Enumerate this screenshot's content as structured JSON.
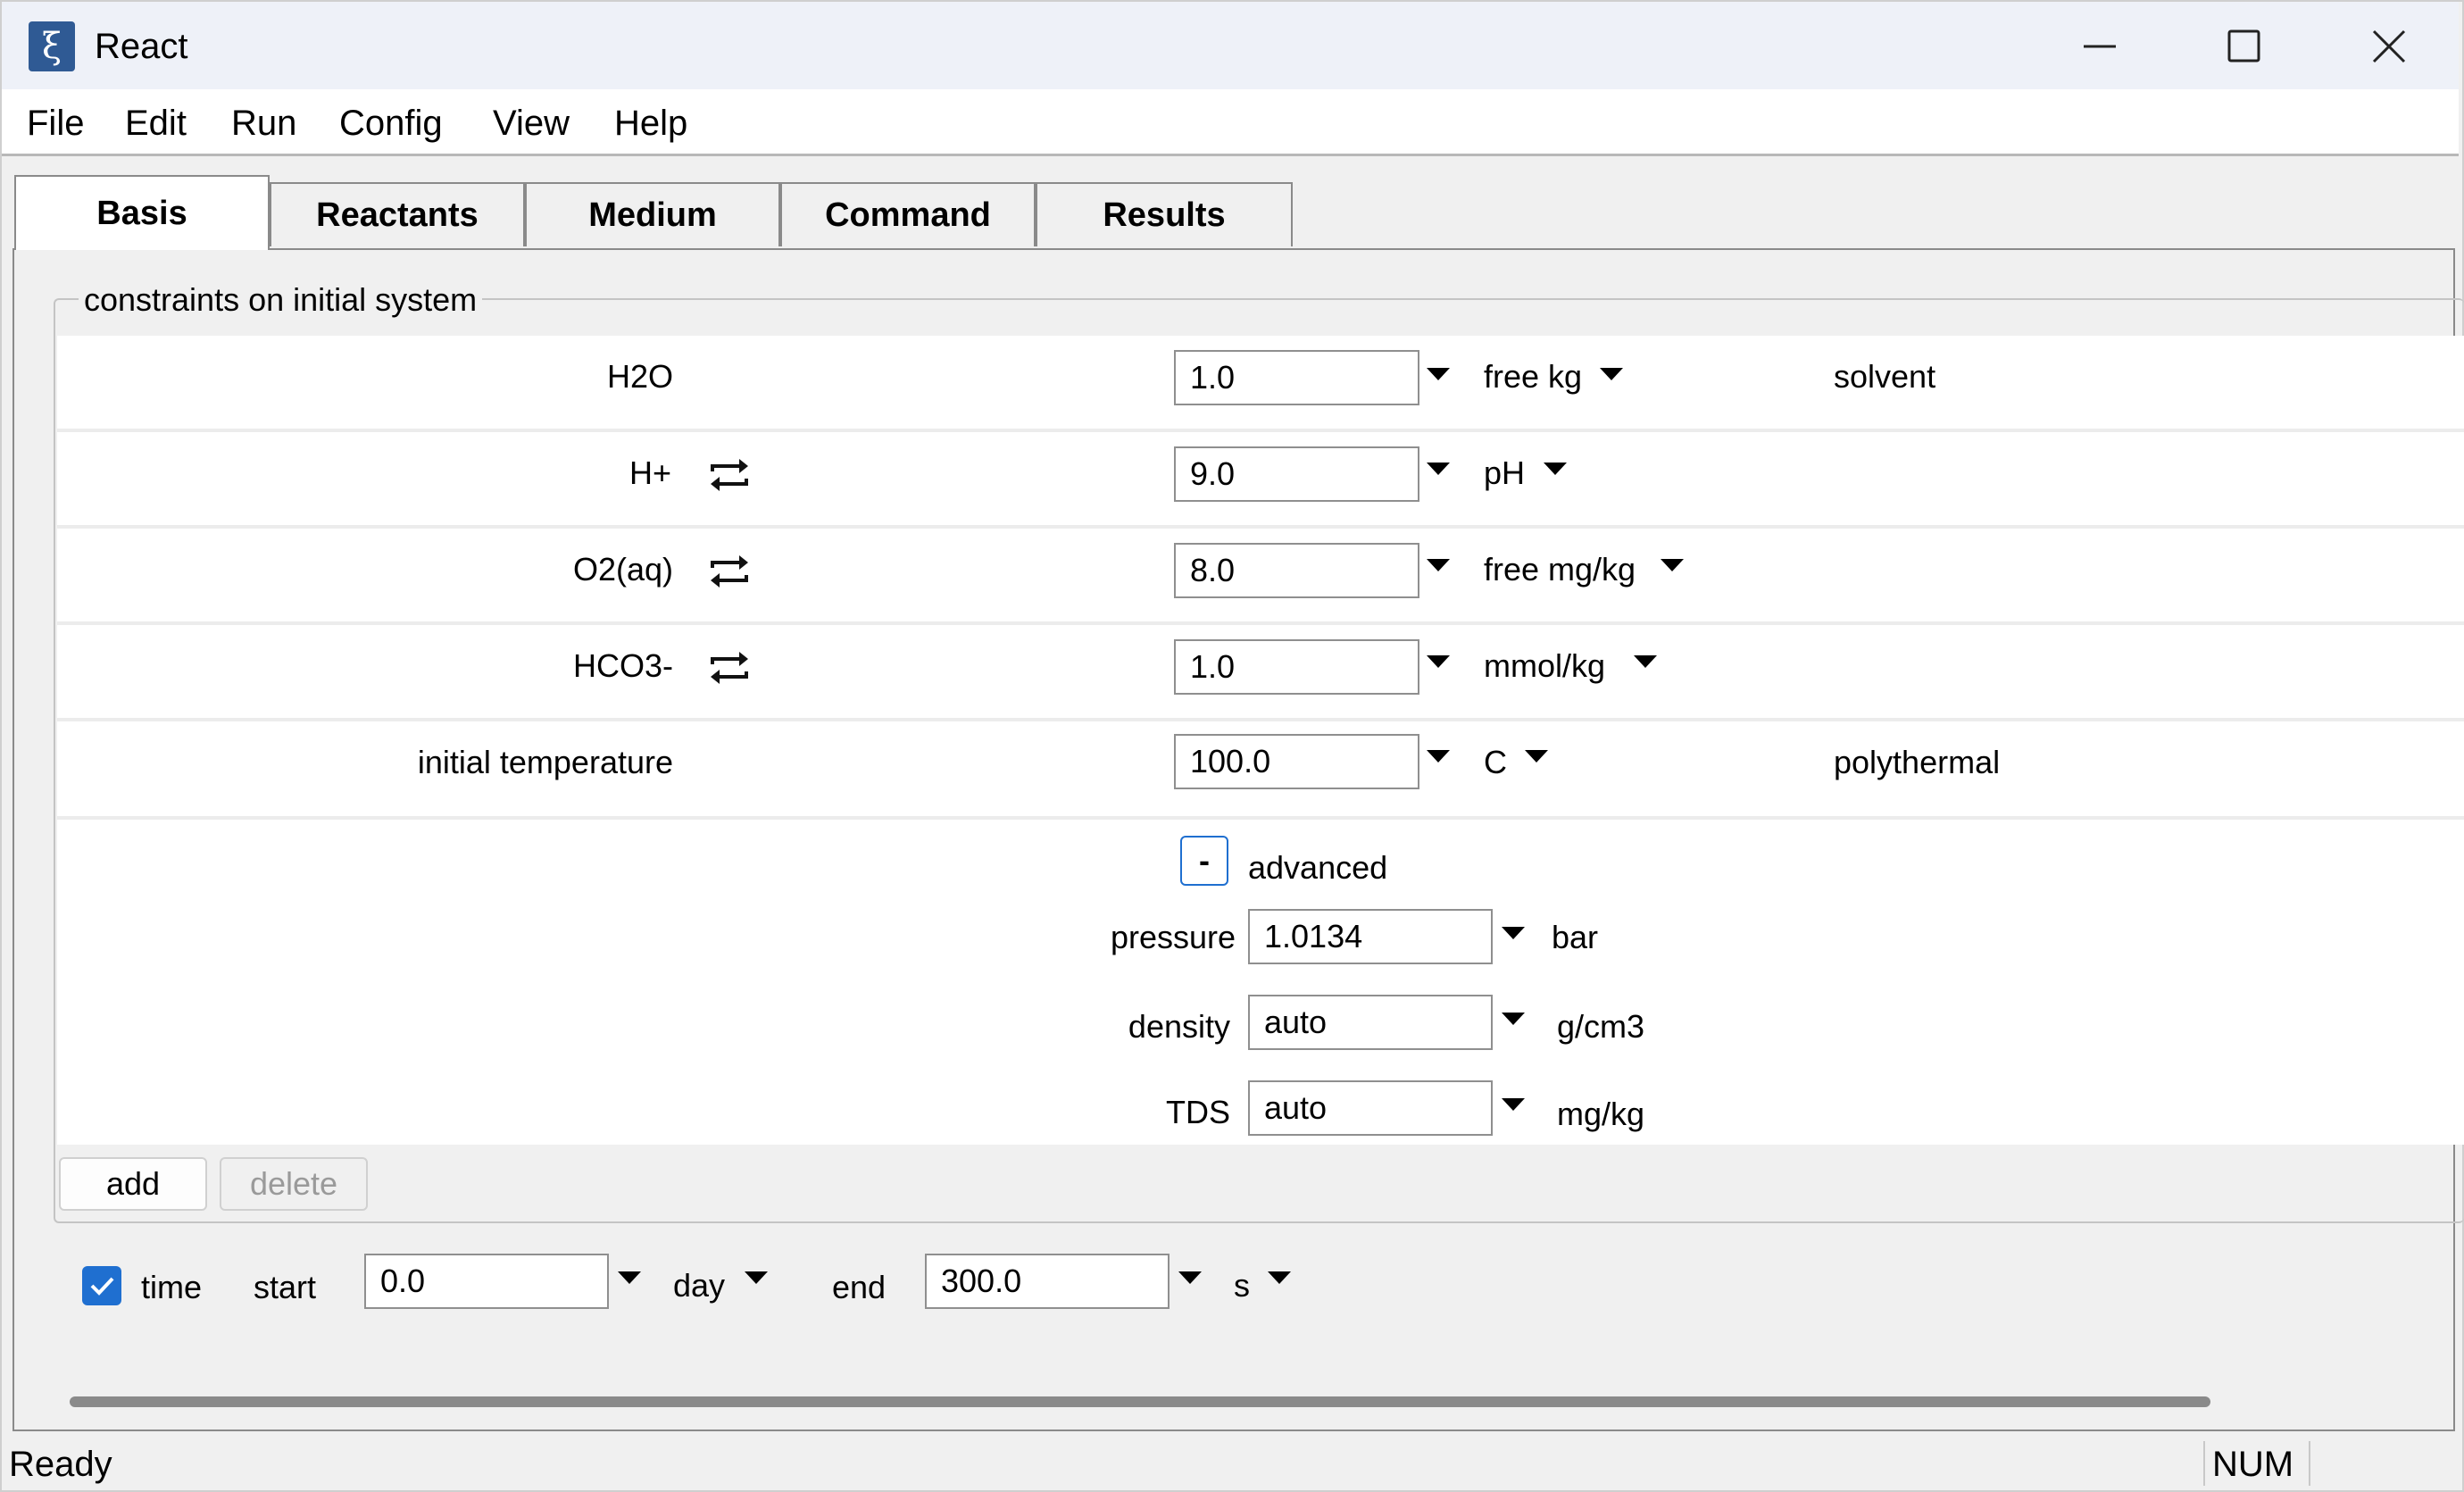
{
  "app": {
    "title": "React",
    "icon_glyph": "ξ",
    "icon_color": "#2f5a94"
  },
  "window_controls": [
    "minimize-icon",
    "maximize-icon",
    "close-icon"
  ],
  "menu": [
    "File",
    "Edit",
    "Run",
    "Config",
    "View",
    "Help"
  ],
  "tabs": [
    {
      "label": "Basis",
      "active": true
    },
    {
      "label": "Reactants"
    },
    {
      "label": "Medium"
    },
    {
      "label": "Command"
    },
    {
      "label": "Results"
    }
  ],
  "group": {
    "title": "constraints on initial system",
    "rows": [
      {
        "species": "H2O",
        "swap": false,
        "value": "1.0",
        "unit": "free kg",
        "note": "solvent"
      },
      {
        "species": "H+",
        "swap": true,
        "value": "9.0",
        "unit": "pH",
        "note": ""
      },
      {
        "species": "O2(aq)",
        "swap": true,
        "value": "8.0",
        "unit": "free mg/kg",
        "note": ""
      },
      {
        "species": "HCO3-",
        "swap": true,
        "value": "1.0",
        "unit": "mmol/kg",
        "note": ""
      },
      {
        "species": "initial temperature",
        "swap": false,
        "value": "100.0",
        "unit": "C",
        "note": "polythermal"
      }
    ],
    "advanced": {
      "toggle_label": "-",
      "label": "advanced",
      "pressure": {
        "label": "pressure",
        "value": "1.0134",
        "unit": "bar"
      },
      "density": {
        "label": "density",
        "value": "auto",
        "unit": "g/cm3"
      },
      "tds": {
        "label": "TDS",
        "value": "auto",
        "unit": "mg/kg"
      }
    },
    "add_label": "add",
    "delete_label": "delete"
  },
  "time": {
    "checked": true,
    "label": "time",
    "start_label": "start",
    "start_value": "0.0",
    "start_unit": "day",
    "end_label": "end",
    "end_value": "300.0",
    "end_unit": "s"
  },
  "status": {
    "left": "Ready",
    "right": "NUM"
  },
  "colors": {
    "accent": "#1f6fd0",
    "checkbox": "#1f6fd0"
  }
}
